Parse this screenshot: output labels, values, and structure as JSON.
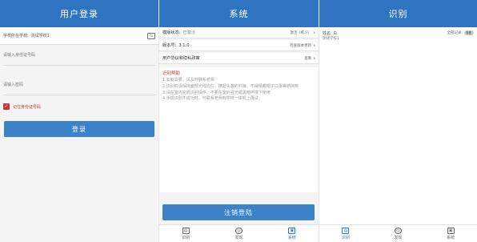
{
  "login": {
    "header": "用户登录",
    "school_label": "学校所在学校:",
    "school_value": "测试学校1",
    "school_icon": "switch-icon",
    "id_placeholder": "请输入身份证号码",
    "pwd_placeholder": "请输入密码",
    "remember_label": "记住身份证号码",
    "remember_checked": true,
    "login_button": "登录"
  },
  "system": {
    "header": "系统",
    "rows": [
      {
        "key": "模版状态:",
        "value": "已激活",
        "right": "激活（练习）"
      },
      {
        "key": "版本号:",
        "value": "3.1.0",
        "right": "检查版本更新"
      },
      {
        "key": "用户协议和隐私政策",
        "value": "",
        "right": "查看"
      }
    ],
    "help_title": "识别帮助",
    "help_items": [
      "1.如有需要，请及时联系老师",
      "2.识别时请保持面部光线均匀，撩起头发的刘海，不得佩戴帽子口罩等遮挡物",
      "3.请在室内完成识别操作，不要在室外强光或黑暗环境下使用",
      "4.手机识别不成功时，可联系老师到学校一体机上再试。"
    ],
    "logout_button": "注销登陆"
  },
  "recognize": {
    "header": "识别",
    "name_label": "姓名: 白",
    "record_label": "全部记录:",
    "toggle_text": "查看",
    "school": "测试学校1"
  },
  "tabs": [
    {
      "label": "识别",
      "icon": "recognize-icon"
    },
    {
      "label": "发现",
      "icon": "discover-icon"
    },
    {
      "label": "系统",
      "icon": "system-icon"
    }
  ],
  "colors": {
    "brand": "#2f74c0",
    "button": "#3b82c8",
    "accent_red": "#c83737"
  }
}
